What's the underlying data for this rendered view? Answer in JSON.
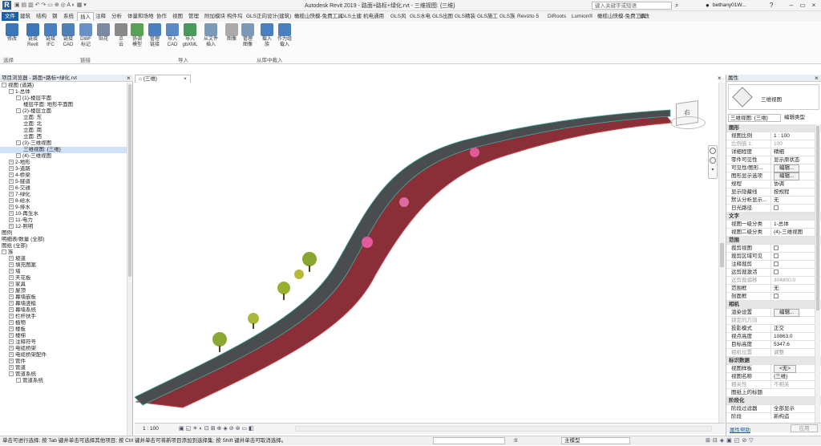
{
  "title": {
    "app_title": "Autodesk Revit 2019 - 路面+路标+绿化.rvt - 三维视图: {三维}",
    "search_placeholder": "键入关键字或短语",
    "user": "bethany01W...",
    "help": "?"
  },
  "ribbon_tabs": [
    "文件",
    "建筑",
    "结构",
    "钢",
    "系统",
    "插入",
    "注释",
    "分析",
    "体量和场地",
    "协作",
    "视图",
    "管理",
    "附加模块",
    "构件坞",
    "GLS正向设计(建筑)",
    "橄榄山快模-免费工具",
    "GLS土建",
    "机电通用",
    "GLS风",
    "GLS水电",
    "GLS出图",
    "GLS精装",
    "GLS施工",
    "GLS族",
    "Revizto 5",
    "DiRoots",
    "Lumion®",
    "橄榄山快模-免费工具",
    "修改"
  ],
  "ribbon_buttons": [
    "修改",
    "链接\nRevit",
    "链接\nIFC",
    "链接\nCAD",
    "DWF\n标记",
    "贴花",
    "点\n云",
    "协调\n模型",
    "管理\n链接",
    "导入\nCAD",
    "导入\ngbXML",
    "从文件\n插入",
    "图像",
    "管理\n图像",
    "载入\n族",
    "作为组\n载入"
  ],
  "ribbon_panels": {
    "select": "选择",
    "link": "链接",
    "import": "导入",
    "load": "从库中载入"
  },
  "browser": {
    "title": "项目浏览器 - 路面+路标+绿化.rvt",
    "close": "×",
    "items": [
      {
        "t": "视图 (道路)",
        "lvl": 0,
        "e": "-"
      },
      {
        "t": "1-总体",
        "lvl": 1,
        "e": "-"
      },
      {
        "t": "(1)-楼层平面",
        "lvl": 2,
        "e": "-"
      },
      {
        "t": "楼层平面: 地形平面图",
        "lvl": 3,
        "e": ""
      },
      {
        "t": "(2)-楼层立面",
        "lvl": 2,
        "e": "-"
      },
      {
        "t": "立面: 东",
        "lvl": 3,
        "e": ""
      },
      {
        "t": "立面: 北",
        "lvl": 3,
        "e": ""
      },
      {
        "t": "立面: 南",
        "lvl": 3,
        "e": ""
      },
      {
        "t": "立面: 西",
        "lvl": 3,
        "e": ""
      },
      {
        "t": "(3)-三维视图",
        "lvl": 2,
        "e": "-"
      },
      {
        "t": "三维视图: {三维}",
        "lvl": 3,
        "e": "",
        "sel": true
      },
      {
        "t": "(4)-三维视图",
        "lvl": 2,
        "e": "-"
      },
      {
        "t": "2-地形",
        "lvl": 1,
        "e": "+"
      },
      {
        "t": "3-道路",
        "lvl": 1,
        "e": "+"
      },
      {
        "t": "4-桥梁",
        "lvl": 1,
        "e": "+"
      },
      {
        "t": "5-隧道",
        "lvl": 1,
        "e": "+"
      },
      {
        "t": "6-交通",
        "lvl": 1,
        "e": "+"
      },
      {
        "t": "7-绿化",
        "lvl": 1,
        "e": "+"
      },
      {
        "t": "8-给水",
        "lvl": 1,
        "e": "+"
      },
      {
        "t": "9-排水",
        "lvl": 1,
        "e": "+"
      },
      {
        "t": "10-再生水",
        "lvl": 1,
        "e": "+"
      },
      {
        "t": "11-电力",
        "lvl": 1,
        "e": "+"
      },
      {
        "t": "12-照明",
        "lvl": 1,
        "e": "+"
      },
      {
        "t": "图例",
        "lvl": 0,
        "e": ""
      },
      {
        "t": "明细表/数量 (全部)",
        "lvl": 0,
        "e": ""
      },
      {
        "t": "图纸 (全部)",
        "lvl": 0,
        "e": ""
      },
      {
        "t": "族",
        "lvl": 0,
        "e": "-"
      },
      {
        "t": "坡道",
        "lvl": 1,
        "e": "+"
      },
      {
        "t": "填充图案",
        "lvl": 1,
        "e": "+"
      },
      {
        "t": "墙",
        "lvl": 1,
        "e": "+"
      },
      {
        "t": "天花板",
        "lvl": 1,
        "e": "+"
      },
      {
        "t": "家具",
        "lvl": 1,
        "e": "+"
      },
      {
        "t": "屋顶",
        "lvl": 1,
        "e": "+"
      },
      {
        "t": "幕墙嵌板",
        "lvl": 1,
        "e": "+"
      },
      {
        "t": "幕墙竖梃",
        "lvl": 1,
        "e": "+"
      },
      {
        "t": "幕墙系统",
        "lvl": 1,
        "e": "+"
      },
      {
        "t": "栏杆扶手",
        "lvl": 1,
        "e": "+"
      },
      {
        "t": "植物",
        "lvl": 1,
        "e": "+"
      },
      {
        "t": "楼板",
        "lvl": 1,
        "e": "+"
      },
      {
        "t": "楼梯",
        "lvl": 1,
        "e": "+"
      },
      {
        "t": "注释符号",
        "lvl": 1,
        "e": "+"
      },
      {
        "t": "电缆桥架",
        "lvl": 1,
        "e": "+"
      },
      {
        "t": "电缆桥架配件",
        "lvl": 1,
        "e": "+"
      },
      {
        "t": "管件",
        "lvl": 1,
        "e": "+"
      },
      {
        "t": "管道",
        "lvl": 1,
        "e": "+"
      },
      {
        "t": "管道系统",
        "lvl": 1,
        "e": "-"
      },
      {
        "t": "管道系统",
        "lvl": 2,
        "e": "-"
      }
    ]
  },
  "view": {
    "tab_label": "{三维}",
    "tab_close": "×",
    "scale": "1 : 100",
    "cube_label": "右"
  },
  "properties": {
    "title": "属性",
    "close": "×",
    "type_name": "三维视图",
    "selector": "三维视图: {三维}",
    "edit_type": "编辑类型",
    "apply": "应用",
    "help_link": "属性帮助",
    "rows": [
      {
        "k": "图形",
        "grp": true
      },
      {
        "k": "视图比例",
        "v": "1 : 100"
      },
      {
        "k": "比例值 1:",
        "v": "100",
        "dim": true
      },
      {
        "k": "详细程度",
        "v": "精细"
      },
      {
        "k": "零件可见性",
        "v": "显示原状态"
      },
      {
        "k": "可见性/图形...",
        "v": "编辑...",
        "btn": true
      },
      {
        "k": "图形显示选项",
        "v": "编辑...",
        "btn": true
      },
      {
        "k": "规程",
        "v": "协调"
      },
      {
        "k": "显示隐藏线",
        "v": "按规程"
      },
      {
        "k": "默认分析显示...",
        "v": "无"
      },
      {
        "k": "日光路径",
        "cb": true
      },
      {
        "k": "文字",
        "grp": true
      },
      {
        "k": "视图一级分类",
        "v": "1-总体"
      },
      {
        "k": "视图二级分类",
        "v": "(4)-三维视图"
      },
      {
        "k": "范围",
        "grp": true
      },
      {
        "k": "裁剪视图",
        "cb": true
      },
      {
        "k": "裁剪区域可见",
        "cb": true
      },
      {
        "k": "注释裁剪",
        "cb": true
      },
      {
        "k": "远剪裁激活",
        "cb": true
      },
      {
        "k": "远剪裁偏移",
        "v": "304800.0",
        "dim": true
      },
      {
        "k": "范围框",
        "v": "无"
      },
      {
        "k": "剖面框",
        "cb": true
      },
      {
        "k": "相机",
        "grp": true
      },
      {
        "k": "渲染设置",
        "v": "编辑...",
        "btn": true
      },
      {
        "k": "锁定的方向",
        "v": "",
        "dim": true
      },
      {
        "k": "投影模式",
        "v": "正交"
      },
      {
        "k": "视点高度",
        "v": "10863.0"
      },
      {
        "k": "目标高度",
        "v": "5347.6"
      },
      {
        "k": "相机位置",
        "v": "调整",
        "dim": true
      },
      {
        "k": "标识数据",
        "grp": true
      },
      {
        "k": "视图样板",
        "v": "<无>",
        "btn": true
      },
      {
        "k": "视图名称",
        "v": "{三维}"
      },
      {
        "k": "相关性",
        "v": "不相关",
        "dim": true
      },
      {
        "k": "图纸上的标题",
        "v": ""
      },
      {
        "k": "阶段化",
        "grp": true
      },
      {
        "k": "阶段过滤器",
        "v": "全部显示"
      },
      {
        "k": "阶段",
        "v": "新构造"
      }
    ]
  },
  "status": {
    "text": "单击可进行选择; 按 Tab 键并单击可选择其他项目; 按 Ctrl 键并单击可将新项目添加到选择集; 按 Shift 键并单击可取消选择。",
    "model": "主模型",
    "zoom": ":0"
  },
  "colors": {
    "road": "#4a4d4f",
    "road_edge": "#c9444f",
    "slope": "#7a2830",
    "file_tab": "#1f5fa8"
  }
}
